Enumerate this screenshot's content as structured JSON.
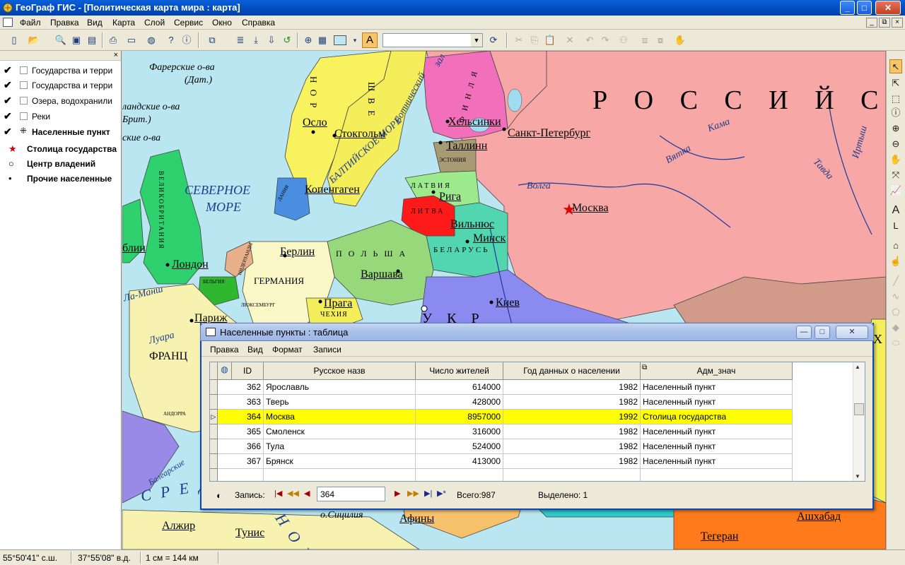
{
  "window": {
    "title": "ГеоГраф ГИС - [Политическая карта мира : карта]",
    "controls": {
      "minimize": "_",
      "maximize": "□",
      "close": "✕"
    },
    "colors": {
      "titlebar": "#0352c8",
      "highlight_row": "#ffff00"
    }
  },
  "menu": {
    "items": [
      "Файл",
      "Правка",
      "Вид",
      "Карта",
      "Слой",
      "Сервис",
      "Окно",
      "Справка"
    ],
    "mdi": {
      "minimize": "_",
      "restore": "⧉",
      "close": "×"
    }
  },
  "toolbar": {
    "icons": [
      "new-icon",
      "open-icon",
      "find-icon",
      "save-icon",
      "save-all-icon",
      "print-icon",
      "window-icon",
      "globe-icon",
      "what-icon",
      "help-icon",
      "layers-icon",
      "align-icon",
      "download-icon",
      "import-icon",
      "undo-refresh-icon",
      "target-icon",
      "properties-icon",
      "color-icon",
      "font-icon",
      "cut-icon",
      "copy-icon",
      "paste-icon",
      "delete-icon",
      "undo-icon",
      "redo-icon",
      "binoculars-icon",
      "group-icon",
      "ungroup-icon",
      "hand-icon"
    ],
    "font_button": "A",
    "combo_value": ""
  },
  "legend": {
    "close": "×",
    "layers": [
      {
        "label": "Государства и терри",
        "checked": true
      },
      {
        "label": "Государства и терри",
        "checked": true
      },
      {
        "label": "Озера, водохранили",
        "checked": true
      },
      {
        "label": "Реки",
        "checked": true
      },
      {
        "label": "Населенные пункт",
        "checked": true,
        "bold": true
      }
    ],
    "symbols": [
      {
        "label": "Столица государства",
        "symbol": "★"
      },
      {
        "label": "Центр владений",
        "symbol": "○"
      },
      {
        "label": "Прочие населенные",
        "symbol": "•"
      }
    ]
  },
  "map": {
    "labels": {
      "russia": "Р О С С И Й С К",
      "moscow": "Москва",
      "spb": "Санкт-Петербург",
      "helsinki": "Хельсинки",
      "tallinn": "Таллинн",
      "riga": "Рига",
      "vilnius": "Вильнюс",
      "minsk": "Минск",
      "warsaw": "Варшава",
      "kiev": "Киев",
      "berlin": "Берлин",
      "praga": "Прага",
      "london": "Лондон",
      "paris": "Париж",
      "oslo": "Осло",
      "stockholm": "Стокгольм",
      "copenhagen": "Копенгаген",
      "dublin": "блин",
      "alzhir": "Алжир",
      "tunis": "Тунис",
      "athens": "Афины",
      "tehran": "Тегеран",
      "ashgabat": "Ашхабад",
      "north_sea": "СЕВЕРНОЕ МОРЕ",
      "north_sea_1": "СЕВЕРНОЕ",
      "north_sea_2": "МОРЕ",
      "baltic_sea": "БАЛТИЙСКОЕ МОРЕ",
      "bothnia": "Ботнический",
      "faroe": "Фарерские о-ва",
      "faroe_dat": "(Дат.)",
      "shetland": "ландские о-ва",
      "brit": "Брит.)",
      "orkney": "ские о-ва",
      "volga": "Волга",
      "vyatka": "Вятка",
      "kama": "Кама",
      "irtysh": "Иртыш",
      "tavda": "Тавда",
      "la_mansh": "Ла-Манш",
      "luara": "Луара",
      "sredizem": "С Р Е Д",
      "balearic": "Балеарские",
      "sicily": "о.Сицилия",
      "norway": "Н О Р",
      "sweden": "Ш В Е",
      "finland": "Ф И Н Л Я",
      "latvia": "ЛАТВИЯ",
      "lithuania": "ЛИТВА",
      "estonia": "ЭСТОНИЯ",
      "belarus": "БЕЛАРУСЬ",
      "poland": "П О Л Ь Ш А",
      "germany": "ГЕРМАНИЯ",
      "france": "ФРАНЦ",
      "czech": "ЧЕХИЯ",
      "belgium": "БЕЛЬГИЯ",
      "lux": "ЛЮКСЕМБУРГ",
      "andorra": "АНДОРРА",
      "ukraine": "У К Р",
      "great_britain": "ВЕЛИКОБРИТАНИЯ",
      "denmark": "ДАНИЯ",
      "netherlands": "НИДЕРЛАНДЫ",
      "n_letter_sea": "Н О Е",
      "x_right": "Х",
      "zaliv": "зал"
    }
  },
  "table_window": {
    "title": "Населенные пункты : таблица",
    "controls": {
      "minimize": "—",
      "maximize": "□",
      "close": "✕"
    },
    "menu": [
      "Правка",
      "Вид",
      "Формат",
      "Записи"
    ],
    "columns": [
      "ID",
      "Русское назв",
      "Число жителей",
      "Год данных о населении",
      "Адм_знач"
    ],
    "rows": [
      {
        "id": "362",
        "name": "Ярославль",
        "pop": "614000",
        "year": "1982",
        "adm": "Населенный пункт",
        "selected": false
      },
      {
        "id": "363",
        "name": "Тверь",
        "pop": "428000",
        "year": "1982",
        "adm": "Населенный пункт",
        "selected": false
      },
      {
        "id": "364",
        "name": "Москва",
        "pop": "8957000",
        "year": "1992",
        "adm": "Столица государства",
        "selected": true
      },
      {
        "id": "365",
        "name": "Смоленск",
        "pop": "316000",
        "year": "1982",
        "adm": "Населенный пункт",
        "selected": false
      },
      {
        "id": "366",
        "name": "Тула",
        "pop": "524000",
        "year": "1982",
        "adm": "Населенный пункт",
        "selected": false
      },
      {
        "id": "367",
        "name": "Брянск",
        "pop": "413000",
        "year": "1982",
        "adm": "Населенный пункт",
        "selected": false
      }
    ],
    "nav": {
      "record_label": "Запись:",
      "record_value": "364",
      "total": "Всего:987",
      "selected": "Выделено: 1",
      "first": "|◀",
      "prev_page": "◀◀",
      "prev": "◀",
      "next": "▶",
      "next_page": "▶▶",
      "last": "▶|",
      "new": "▶*"
    }
  },
  "status": {
    "lat": "55°50'41\" с.ш.",
    "lon": "37°55'08\" в.д.",
    "scale": "1 см = 144 км"
  }
}
